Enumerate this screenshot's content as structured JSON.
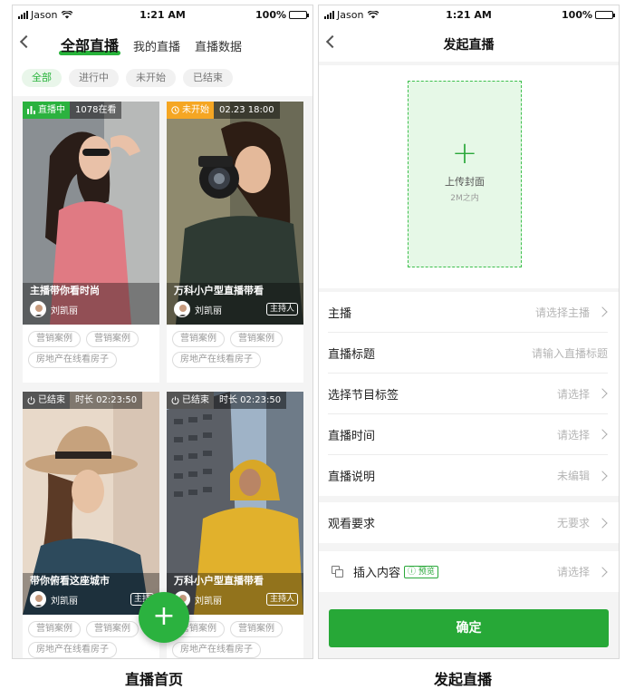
{
  "status_bar": {
    "carrier": "Jason",
    "time": "1:21 AM",
    "battery": "100%"
  },
  "left": {
    "tabs": [
      "全部直播",
      "我的直播",
      "直播数据"
    ],
    "filters": [
      "全部",
      "进行中",
      "未开始",
      "已结束"
    ],
    "cards": [
      {
        "status": "直播中",
        "status_color": "#2bb23f",
        "info": "1078在看",
        "title": "主播带你看时尚",
        "anchor": "刘凯丽",
        "host_tag": "",
        "tags": [
          "营销案例",
          "营销案例",
          "房地产在线看房子"
        ]
      },
      {
        "status": "未开始",
        "status_color": "#f5a623",
        "info": "02.23 18:00",
        "title": "万科小户型直播带看",
        "anchor": "刘凯丽",
        "host_tag": "主持人",
        "tags": [
          "营销案例",
          "营销案例",
          "房地产在线看房子"
        ]
      },
      {
        "status": "已结束",
        "status_color": "#555555",
        "info": "时长 02:23:50",
        "title": "带你俯看这座城市",
        "anchor": "刘凯丽",
        "host_tag": "主持",
        "tags": [
          "营销案例",
          "营销案例",
          "房地产在线看房子"
        ]
      },
      {
        "status": "已结束",
        "status_color": "#555555",
        "info": "时长 02:23:50",
        "title": "万科小户型直播带看",
        "anchor": "刘凯丽",
        "host_tag": "主持人",
        "tags": [
          "营销案例",
          "营销案例",
          "房地产在线看房子"
        ]
      }
    ],
    "fab_icon": "plus-icon",
    "fab_label": "+"
  },
  "right": {
    "title": "发起直播",
    "upload": {
      "plus": "+",
      "label": "上传封面",
      "hint": "2M之内"
    },
    "form_group1": [
      {
        "label": "主播",
        "value": "请选择主播",
        "chevron": true
      },
      {
        "label": "直播标题",
        "value": "请输入直播标题",
        "chevron": false
      },
      {
        "label": "选择节目标签",
        "value": "请选择",
        "chevron": true
      },
      {
        "label": "直播时间",
        "value": "请选择",
        "chevron": true
      },
      {
        "label": "直播说明",
        "value": "未编辑",
        "chevron": true
      }
    ],
    "requirement": {
      "label": "观看要求",
      "value": "无要求"
    },
    "insert": {
      "label": "插入内容",
      "preview": "预览",
      "value": "请选择"
    },
    "confirm": "确定"
  },
  "captions": {
    "left": "直播首页",
    "right": "发起直播"
  },
  "colors": {
    "accent": "#27a837",
    "live": "#2bb23f",
    "upcoming": "#f5a623",
    "ended": "#555555"
  }
}
